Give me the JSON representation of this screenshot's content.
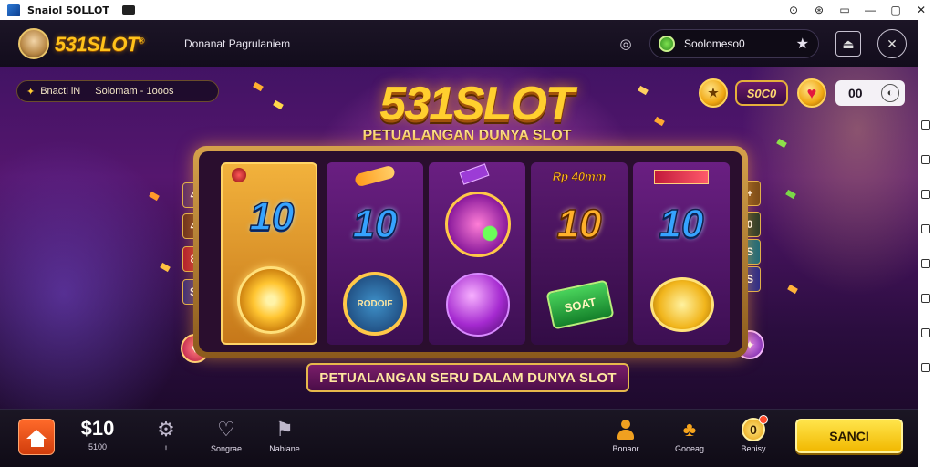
{
  "window": {
    "title": "Snaiol SOLLOT",
    "controls": [
      "⊙",
      "⊛",
      "▭",
      "—",
      "▢",
      "✕"
    ]
  },
  "header": {
    "logo": "531SLOT",
    "logo_tm": "®",
    "subtitle": "Donanat Pagrulaniem",
    "balance_label": "Soolomeso0",
    "icons": {
      "camera": "camera-icon",
      "star": "star-icon",
      "exit": "exit-icon",
      "close": "close-icon"
    }
  },
  "info_bar": {
    "left_text": "Bnactl lN",
    "right_text": "Solomam - 1ooos"
  },
  "top_right": {
    "coin_value": "S0C0",
    "counter": "00"
  },
  "game": {
    "title": "531SLOT",
    "tagline": "PETUALANGAN DUNYA SLOT",
    "banner": "PETUALANGAN SERU DALAM DUNYA SLOT",
    "reels": [
      {
        "top_label": "",
        "top": "10",
        "bottom": "sun-coin"
      },
      {
        "top_label": "",
        "top": "10",
        "bottom": "RODOIF"
      },
      {
        "top_label": "",
        "top": "gem",
        "bottom": "orb"
      },
      {
        "top_label": "Rp 40mm",
        "top": "10",
        "bottom": "SOAT"
      },
      {
        "top_label": "",
        "top": "10",
        "bottom": "badge"
      }
    ],
    "left_paylines": [
      "4",
      "4",
      "8",
      "S"
    ],
    "right_paylines": [
      "+",
      "0",
      "S",
      "S"
    ]
  },
  "bottom_bar": {
    "bet_value": "$10",
    "bet_label": "5100",
    "nav": [
      {
        "icon": "gear-icon",
        "label": "!"
      },
      {
        "icon": "heart-icon",
        "label": "Songrae"
      },
      {
        "icon": "flag-icon",
        "label": "Nabiane"
      }
    ],
    "right_items": [
      {
        "icon": "profile-icon",
        "label": "Bonaor"
      },
      {
        "icon": "club-icon",
        "label": "Gooeag"
      },
      {
        "icon": "zero-coin-icon",
        "label": "Benisy"
      }
    ],
    "spin_label": "SANCI"
  },
  "colors": {
    "accent_gold": "#ffc21a",
    "spin_yellow": "#ffe44a",
    "home_orange": "#ff6a2a",
    "title_bar": "#ffffff"
  }
}
